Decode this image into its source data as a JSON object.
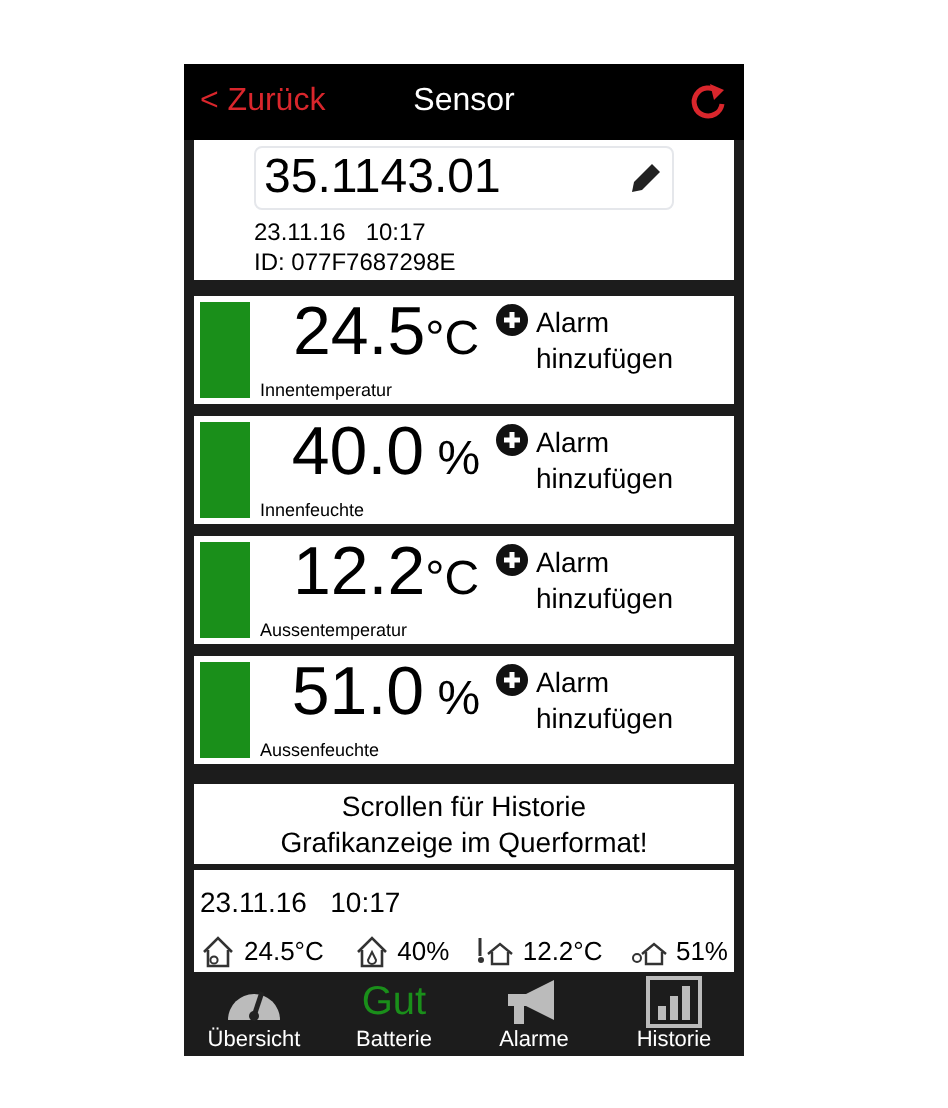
{
  "nav": {
    "back": "< Zurück",
    "title": "Sensor"
  },
  "sensor": {
    "name": "35.1143.01",
    "date": "23.11.16",
    "time": "10:17",
    "id": "ID: 077F7687298E"
  },
  "readings": [
    {
      "value": "24.5",
      "unit": "°C",
      "label": "Innentemperatur",
      "alarm": "Alarm hinzufügen",
      "color": "#1a8f1a"
    },
    {
      "value": "40.0",
      "unit": " %",
      "label": "Innenfeuchte",
      "alarm": "Alarm hinzufügen",
      "color": "#1a8f1a"
    },
    {
      "value": "12.2",
      "unit": "°C",
      "label": "Aussentemperatur",
      "alarm": "Alarm hinzufügen",
      "color": "#1a8f1a"
    },
    {
      "value": "51.0",
      "unit": " %",
      "label": "Aussenfeuchte",
      "alarm": "Alarm hinzufügen",
      "color": "#1a8f1a"
    }
  ],
  "notice": [
    "Scrollen für Historie",
    "Grafikanzeige im Querformat!"
  ],
  "history": {
    "date": "23.11.16",
    "time": "10:17",
    "values": [
      {
        "kind": "indoor-temp",
        "text": "24.5°C"
      },
      {
        "kind": "indoor-humidity",
        "text": "40%"
      },
      {
        "kind": "outdoor-temp",
        "text": "12.2°C"
      },
      {
        "kind": "outdoor-humidity",
        "text": "51%"
      }
    ]
  },
  "tabs": [
    {
      "kind": "gauge",
      "label": "Übersicht",
      "selected": false
    },
    {
      "kind": "battery",
      "status": "Gut",
      "label": "Batterie",
      "selected": false
    },
    {
      "kind": "megaphone",
      "label": "Alarme",
      "selected": false
    },
    {
      "kind": "chart",
      "label": "Historie",
      "selected": false
    }
  ]
}
